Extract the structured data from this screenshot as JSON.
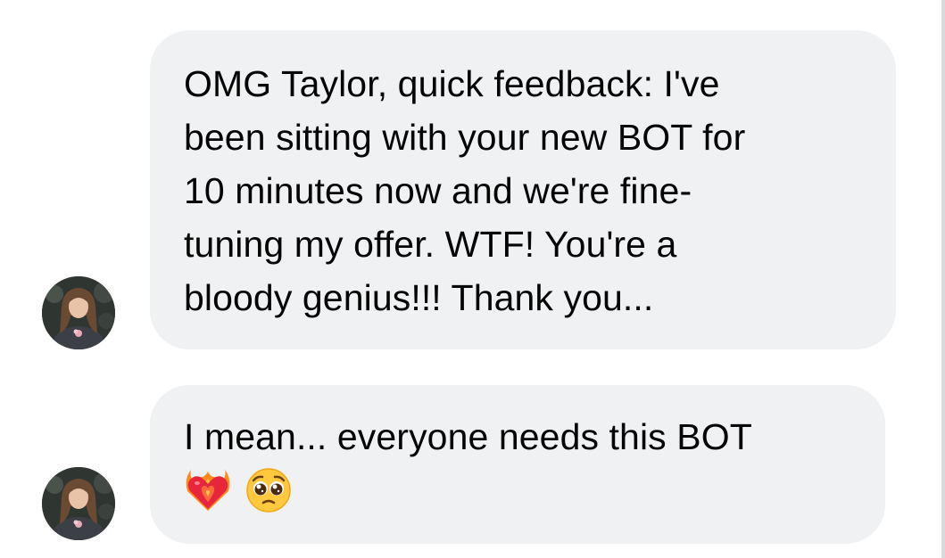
{
  "conversation": {
    "messages": [
      {
        "lines": [
          "OMG Taylor, quick feedback: I've",
          "been sitting with your new BOT for",
          "10 minutes now and we're fine-",
          "tuning my offer. WTF! You're a",
          "bloody genius!!! Thank you..."
        ],
        "avatar_icon": "user-avatar"
      },
      {
        "lines": [
          "I mean... everyone needs this BOT"
        ],
        "emojis": [
          "heart-on-fire-icon",
          "pleading-face-icon"
        ],
        "avatar_icon": "user-avatar"
      }
    ]
  },
  "colors": {
    "bubble_background": "#f0f1f3",
    "text": "#050505",
    "page_background": "#ffffff"
  }
}
